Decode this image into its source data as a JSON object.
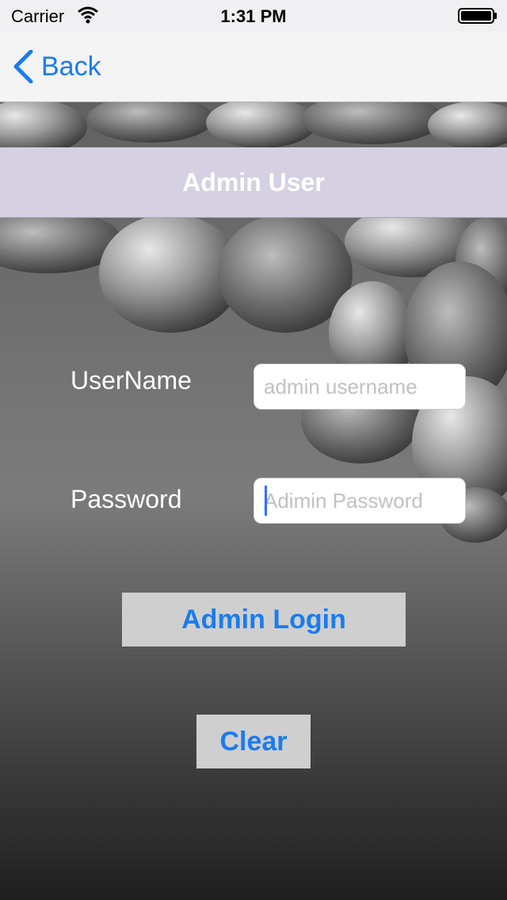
{
  "status_bar": {
    "carrier": "Carrier",
    "time": "1:31 PM"
  },
  "nav": {
    "back_label": "Back"
  },
  "header": {
    "title": "Admin User"
  },
  "form": {
    "username_label": "UserName",
    "username_placeholder": "admin username",
    "password_label": "Password",
    "password_placeholder": "Adimin Password"
  },
  "buttons": {
    "login": "Admin Login",
    "clear": "Clear"
  },
  "colors": {
    "accent": "#1a7cf0",
    "header_band": "#d6d0e3",
    "button_bg": "#cfcfcf"
  }
}
